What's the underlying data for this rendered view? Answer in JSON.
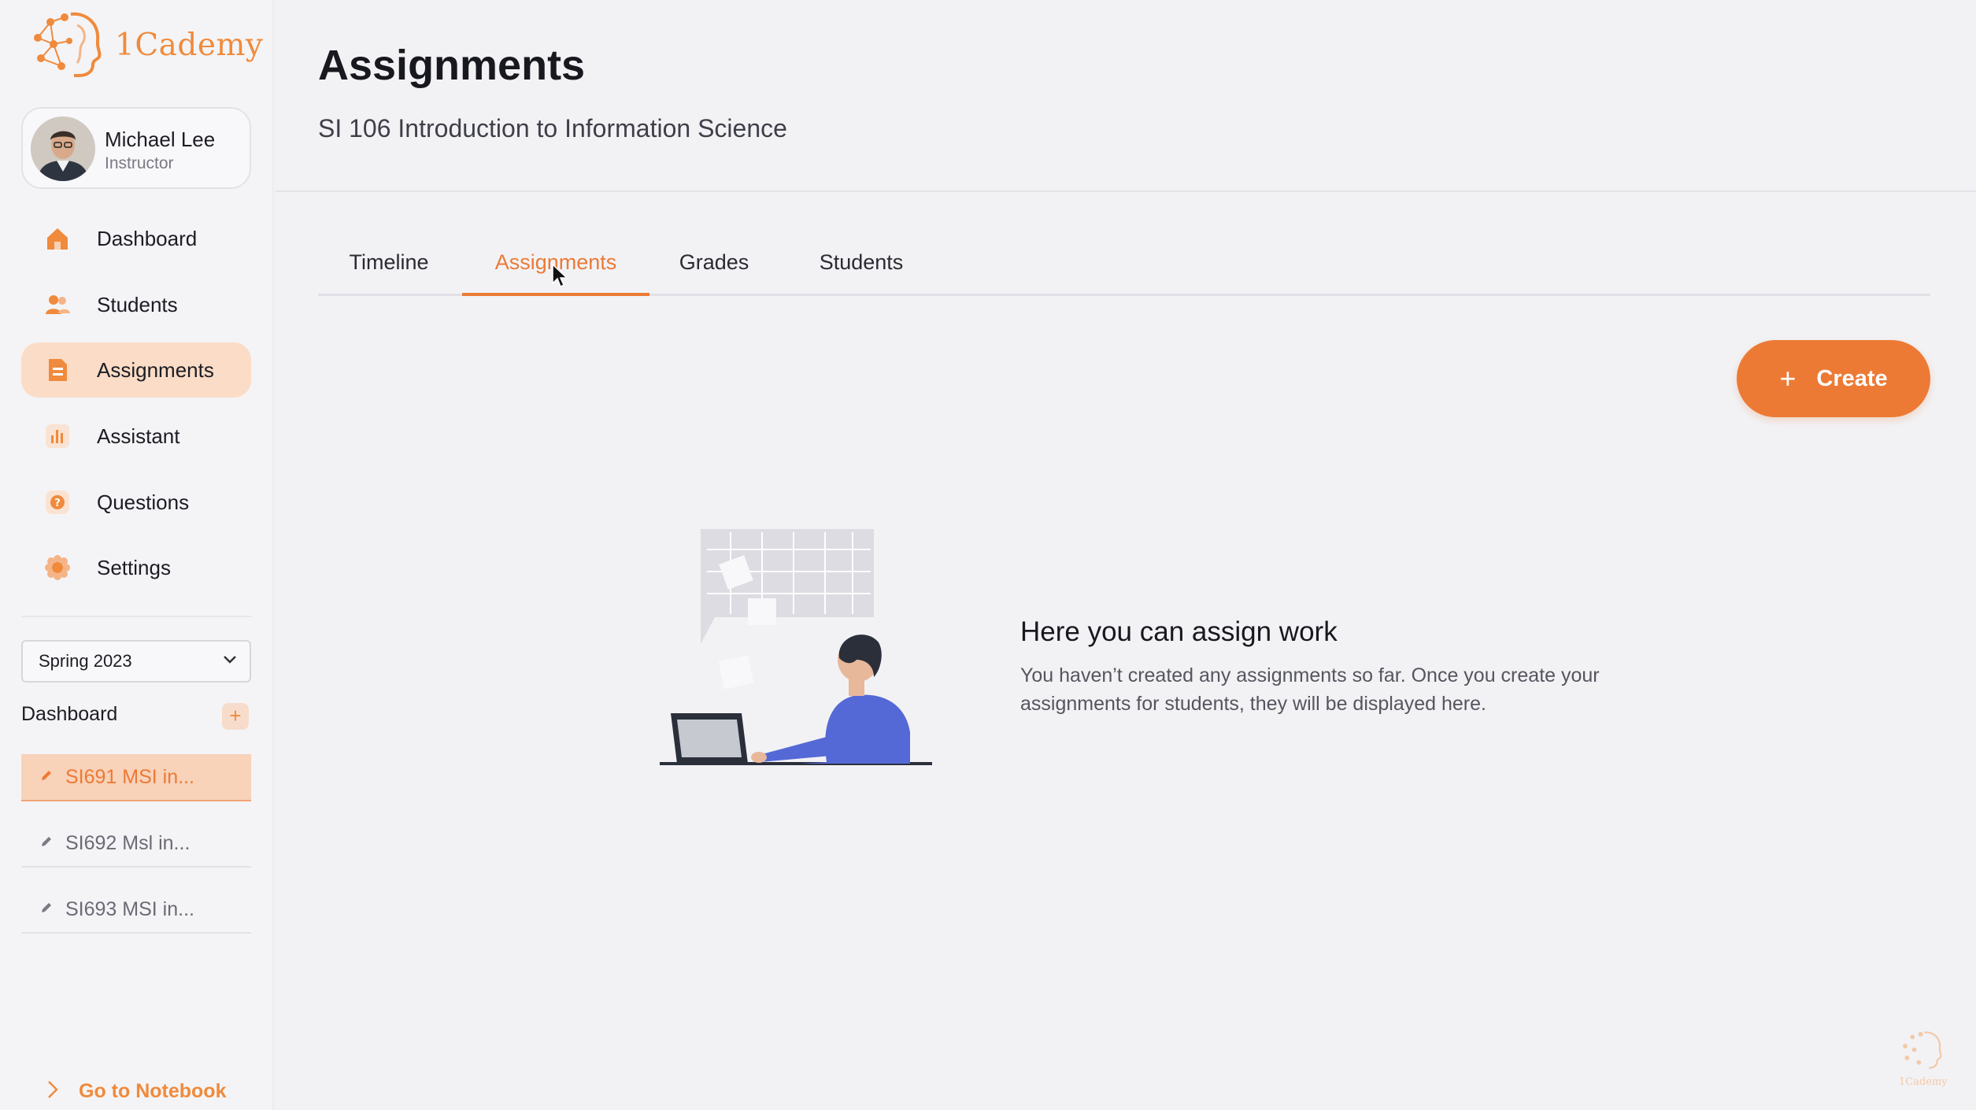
{
  "brand": {
    "name": "1Cademy",
    "accent": "#ec7a35"
  },
  "user": {
    "name": "Michael Lee",
    "role": "Instructor"
  },
  "sidebar": {
    "items": [
      {
        "label": "Dashboard",
        "icon": "home-icon"
      },
      {
        "label": "Students",
        "icon": "users-icon"
      },
      {
        "label": "Assignments",
        "icon": "document-icon",
        "active": true
      },
      {
        "label": "Assistant",
        "icon": "bar-chart-icon"
      },
      {
        "label": "Questions",
        "icon": "question-icon"
      },
      {
        "label": "Settings",
        "icon": "gear-icon"
      }
    ],
    "semester": "Spring 2023",
    "dashboard_heading": "Dashboard",
    "add_label": "+",
    "courses": [
      {
        "label": "SI691 MSI in...",
        "active": true
      },
      {
        "label": "SI692 Msl in..."
      },
      {
        "label": "SI693 MSI in..."
      }
    ],
    "notebook_link": "Go to Notebook"
  },
  "header": {
    "title": "Assignments",
    "subtitle": "SI 106 Introduction to Information Science"
  },
  "tabs": [
    {
      "label": "Timeline"
    },
    {
      "label": "Assignments",
      "active": true
    },
    {
      "label": "Grades"
    },
    {
      "label": "Students"
    }
  ],
  "create_button": {
    "plus": "+",
    "label": "Create"
  },
  "empty_state": {
    "title": "Here you can assign work",
    "description": "You haven’t created any assignments so far. Once you create your assignments for students, they will be displayed here."
  },
  "watermark": "1Cademy"
}
